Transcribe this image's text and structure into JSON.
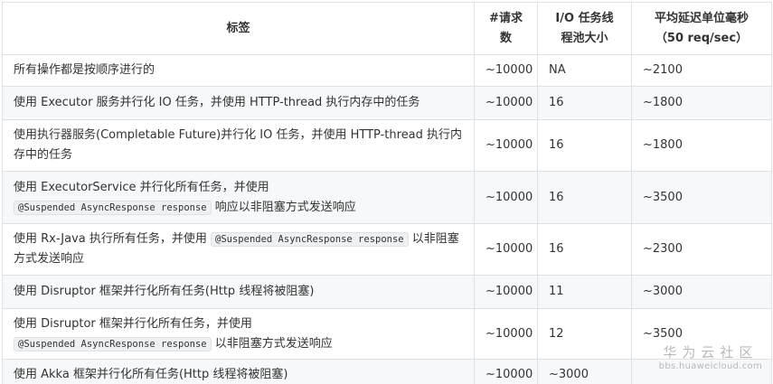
{
  "table": {
    "headers": {
      "label": "标签",
      "requests_line1": "#请求",
      "requests_line2": "数",
      "pool_line1": "I/O 任务线",
      "pool_line2": "程池大小",
      "latency_line1": "平均延迟单位毫秒",
      "latency_line2": "（50 req/sec）"
    },
    "rows": [
      {
        "desc": "所有操作都是按顺序进行的",
        "requests": "~10000",
        "pool": "NA",
        "latency": "~2100"
      },
      {
        "desc": "使用 Executor 服务并行化 IO 任务，并使用 HTTP-thread 执行内存中的任务",
        "requests": "~10000",
        "pool": "16",
        "latency": "~1800"
      },
      {
        "desc": "使用执行器服务(Completable Future)并行化 IO 任务，并使用 HTTP-thread 执行内存中的任务",
        "requests": "~10000",
        "pool": "16",
        "latency": "~1800"
      },
      {
        "desc_pre": "使用 ExecutorService 并行化所有任务，并使用",
        "code": "@Suspended AsyncResponse response",
        "desc_post": "响应以非阻塞方式发送响应",
        "requests": "~10000",
        "pool": "16",
        "latency": "~3500"
      },
      {
        "desc_pre": "使用 Rx-Java 执行所有任务，并使用",
        "code": "@Suspended AsyncResponse response",
        "desc_post": "以非阻塞方式发送响应",
        "requests": "~10000",
        "pool": "16",
        "latency": "~2300"
      },
      {
        "desc": "使用 Disruptor 框架并行化所有任务(Http 线程将被阻塞)",
        "requests": "~10000",
        "pool": "11",
        "latency": "~3000"
      },
      {
        "desc_pre": "使用 Disruptor 框架并行化所有任务，并使用",
        "code": "@Suspended AsyncResponse response",
        "desc_post": "以非阻塞方式发送响应",
        "requests": "~10000",
        "pool": "12",
        "latency": "~3500"
      },
      {
        "desc": "使用 Akka 框架并行化所有任务(Http 线程将被阻塞)",
        "requests": "~10000",
        "pool": "~3000",
        "latency": ""
      }
    ]
  },
  "watermark": {
    "main": "华为云社区",
    "sub": "bbs.huaweicloud.com"
  }
}
